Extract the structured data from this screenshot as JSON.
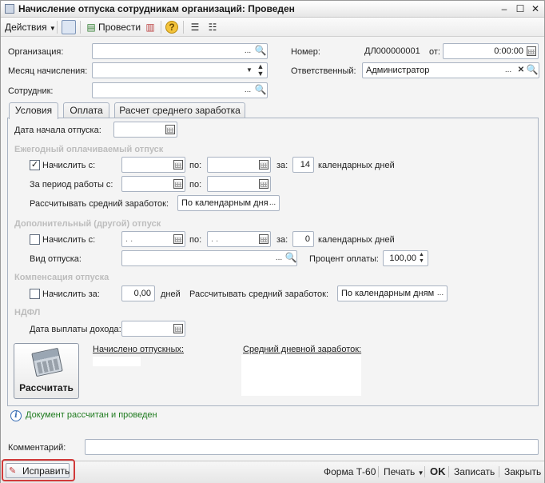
{
  "window": {
    "title": "Начисление отпуска сотрудникам организаций: Проведен",
    "minimize": "–",
    "maximize": "☐",
    "close": "✕"
  },
  "toolbar": {
    "actions_label": "Действия",
    "post_label": "Провести"
  },
  "header": {
    "organization_label": "Организация:",
    "organization_value": "",
    "month_label": "Месяц начисления:",
    "month_value": "",
    "employee_label": "Сотрудник:",
    "employee_value": "",
    "number_label": "Номер:",
    "number_value": "ДЛ000000001",
    "date_label": "от:",
    "date_value": "0:00:00",
    "responsible_label": "Ответственный:",
    "responsible_value": "Администратор"
  },
  "tabs": [
    {
      "label": "Условия"
    },
    {
      "label": "Оплата"
    },
    {
      "label": "Расчет среднего заработка"
    }
  ],
  "conditions": {
    "vacation_start_label": "Дата начала отпуска:",
    "vacation_start_value": "",
    "annual": {
      "section": "Ежегодный оплачиваемый отпуск",
      "accrue_label": "Начислить с:",
      "accrue_checked": "✓",
      "from_value": "",
      "to_label": "по:",
      "to_value": "",
      "for_label": "за:",
      "days_value": "14",
      "days_unit": "календарных дней",
      "period_label": "За период работы с:",
      "period_from": "",
      "period_to_label": "по:",
      "period_to": "",
      "avg_label": "Рассчитывать средний заработок:",
      "avg_value": "По календарным дня"
    },
    "additional": {
      "section": "Дополнительный (другой) отпуск",
      "accrue_label": "Начислить с:",
      "from_value": " .  .",
      "to_label": "по:",
      "to_value": " .  .",
      "for_label": "за:",
      "days_value": "0",
      "days_unit": "календарных дней",
      "type_label": "Вид отпуска:",
      "type_value": "",
      "percent_label": "Процент оплаты:",
      "percent_value": "100,00"
    },
    "compensation": {
      "section": "Компенсация отпуска",
      "accrue_label": "Начислить за:",
      "days_value": "0,00",
      "days_unit": "дней",
      "avg_label": "Рассчитывать средний заработок:",
      "avg_value": "По календарным дням"
    },
    "ndfl": {
      "section": "НДФЛ",
      "payout_label": "Дата выплаты дохода:",
      "payout_value": ""
    },
    "calc_button": "Рассчитать",
    "accrued_label": "Начислено отпускных:",
    "avg_daily_label": "Средний дневной заработок:"
  },
  "status": {
    "info": "i",
    "message": "Документ рассчитан и проведен"
  },
  "comment": {
    "label": "Комментарий:",
    "value": ""
  },
  "footer": {
    "fix_label": "Исправить",
    "form_label": "Форма Т-60",
    "print_label": "Печать",
    "ok_label": "OK",
    "save_label": "Записать",
    "close_label": "Закрыть"
  }
}
